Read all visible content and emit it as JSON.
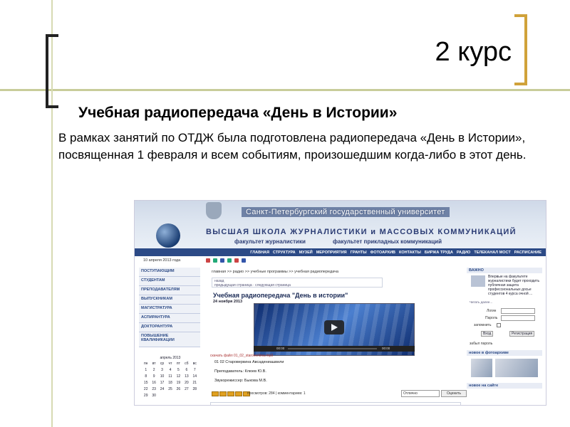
{
  "slide": {
    "title": "2 курс",
    "heading": "Учебная радиопередача «День в Истории»",
    "paragraph": "В рамках занятий по ОТДЖ была подготовлена радиопередача «День в Истории», посвященная 1 февраля и всем событиям, произошедшим когда-либо в этот день."
  },
  "site": {
    "university": "Санкт-Петербургский государственный университет",
    "school": "ВЫСШАЯ ШКОЛА ЖУРНАЛИСТИКИ и МАССОВЫХ КОММУНИКАЦИЙ",
    "faculty_1": "факультет журналистики",
    "faculty_2": "факультет прикладных коммуникаций",
    "nav": [
      "ГЛАВНАЯ",
      "СТРУКТУРА",
      "МУЗЕЙ",
      "МЕРОПРИЯТИЯ",
      "ГРАНТЫ",
      "ФОТОАРХИВ",
      "КОНТАКТЫ",
      "БИРЖА ТРУДА",
      "РАДИО",
      "ТЕЛЕКАНАЛ МОСТ",
      "РАСПИСАНИЕ"
    ],
    "date": "10 апреля 2013 года",
    "sidebar": [
      "ПОСТУПАЮЩИМ",
      "СТУДЕНТАМ",
      "ПРЕПОДАВАТЕЛЯМ",
      "ВЫПУСКНИКАМ",
      "МАГИСТРАТУРА",
      "АСПИРАНТУРА",
      "ДОКТОРАНТУРА",
      "ПОВЫШЕНИЕ КВАЛИФИКАЦИИ"
    ],
    "calendar": {
      "month": "апрель 2013",
      "days": [
        "пн",
        "вт",
        "ср",
        "чт",
        "пт",
        "сб",
        "вс",
        "1",
        "2",
        "3",
        "4",
        "5",
        "6",
        "7",
        "8",
        "9",
        "10",
        "11",
        "12",
        "13",
        "14",
        "15",
        "16",
        "17",
        "18",
        "19",
        "20",
        "21",
        "22",
        "23",
        "24",
        "25",
        "26",
        "27",
        "28",
        "29",
        "30"
      ]
    },
    "breadcrumb": "главная >> радио >> учебные программы >> учебная радиопередача",
    "pager_1": "назад",
    "pager_2": "предыдущая страница · следующая страница",
    "article_title": "Учебная радиопередача \"День в истории\"",
    "article_date": "24 ноября 2013",
    "player_time_start": "00:00",
    "player_time_end": "00:00",
    "download": "скачать файл 01_02_staroverkina.mp3",
    "item_1": "01 02 Староверкина Авсадиниашвили",
    "teacher": "Преподаватель: Клюев Ю.В.",
    "sound": "Звукорежиссер: Быкова М.В.",
    "views": "просмотров: 284 | комментариев: 1",
    "rating_select": "Отлично",
    "rating_button": "Оценить",
    "right_head_1": "ВАЖНО",
    "right_news": "Впервые на факультете журналистики будет проходить публичная защита профессиональных досье студентов 4 курса очной ...",
    "right_more": "Читать далее...",
    "login_label": "Логин",
    "password_label": "Пароль",
    "remember_label": "запомнить",
    "enter_button": "Вход",
    "register_button": "Регистрация",
    "forgot": "забыл пароль",
    "right_head_2": "новое в фотоархиве",
    "right_head_3": "новое на сайте"
  }
}
